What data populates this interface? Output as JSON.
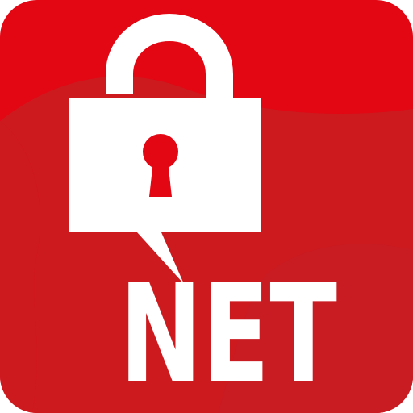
{
  "icon": {
    "semantic": "open-padlock-icon",
    "label": "NET"
  },
  "colors": {
    "background": "#e30613",
    "background_wave": "#cc1a1f",
    "foreground": "#ffffff",
    "keyhole": "#e30613"
  }
}
